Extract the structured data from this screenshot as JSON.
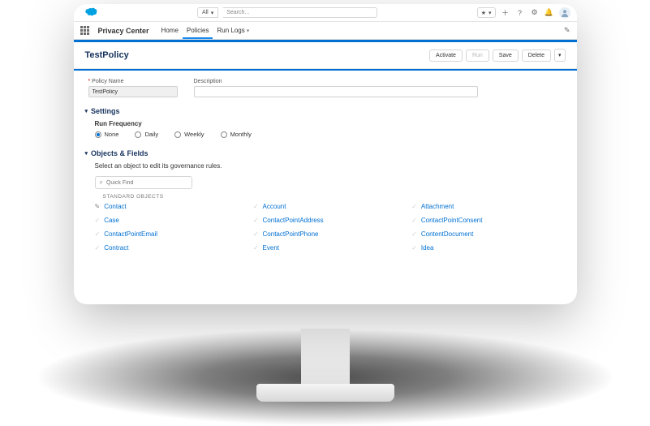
{
  "util": {
    "scope_label": "All",
    "search_placeholder": "Search..."
  },
  "nav": {
    "app_name": "Privacy Center",
    "items": [
      {
        "label": "Home",
        "active": false
      },
      {
        "label": "Policies",
        "active": true
      },
      {
        "label": "Run Logs",
        "active": false,
        "caret": true
      }
    ]
  },
  "header": {
    "title": "TestPolicy",
    "actions": {
      "activate": "Activate",
      "run": "Run",
      "save": "Save",
      "delete": "Delete"
    }
  },
  "fields": {
    "policy_name_label": "Policy Name",
    "policy_name_value": "TestPolicy",
    "description_label": "Description"
  },
  "settings": {
    "section_title": "Settings",
    "run_frequency_label": "Run Frequency",
    "options": [
      {
        "label": "None",
        "selected": true
      },
      {
        "label": "Daily",
        "selected": false
      },
      {
        "label": "Weekly",
        "selected": false
      },
      {
        "label": "Monthly",
        "selected": false
      }
    ]
  },
  "objects": {
    "section_title": "Objects & Fields",
    "caption": "Select an object to edit its governance rules.",
    "quick_find_placeholder": "Quick Find",
    "group_label": "STANDARD OBJECTS",
    "items": [
      {
        "label": "Contact",
        "editing": true
      },
      {
        "label": "Account"
      },
      {
        "label": "Attachment"
      },
      {
        "label": "Case"
      },
      {
        "label": "ContactPointAddress"
      },
      {
        "label": "ContactPointConsent"
      },
      {
        "label": "ContactPointEmail"
      },
      {
        "label": "ContactPointPhone"
      },
      {
        "label": "ContentDocument"
      },
      {
        "label": "Contract"
      },
      {
        "label": "Event"
      },
      {
        "label": "Idea"
      }
    ]
  }
}
